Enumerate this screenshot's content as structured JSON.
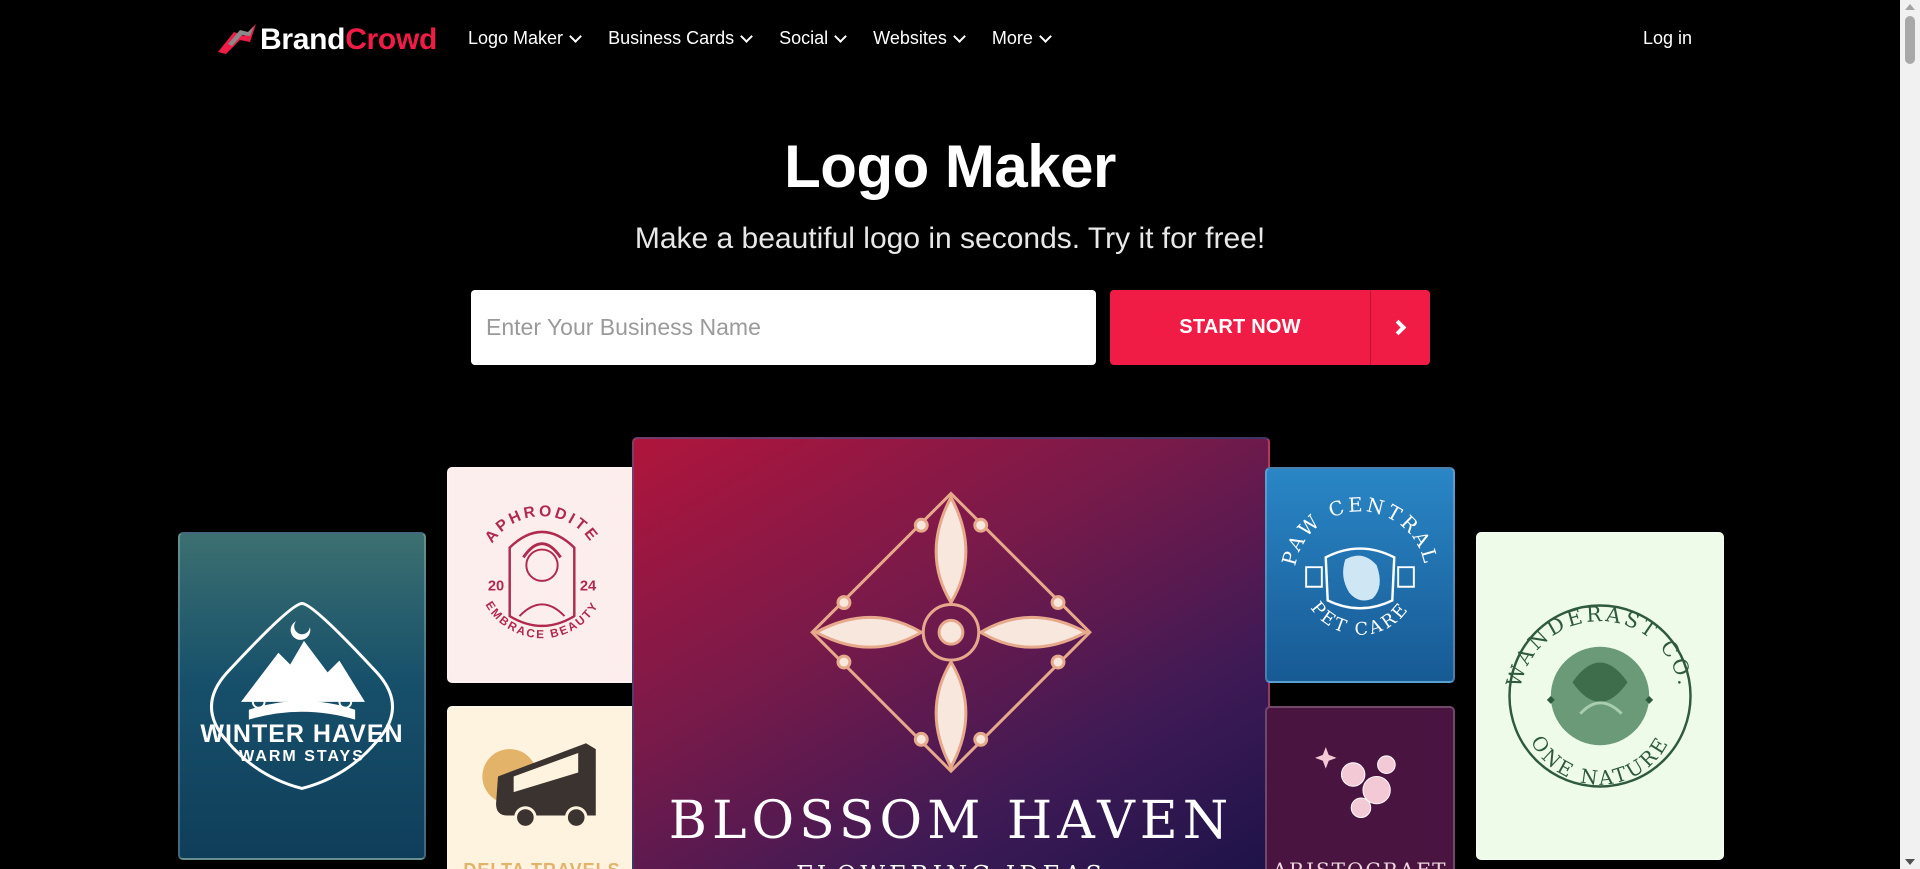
{
  "header": {
    "logo": {
      "brand": "Brand",
      "crowd": "Crowd"
    },
    "nav": [
      {
        "label": "Logo Maker"
      },
      {
        "label": "Business Cards"
      },
      {
        "label": "Social"
      },
      {
        "label": "Websites"
      },
      {
        "label": "More"
      }
    ],
    "login": "Log in"
  },
  "hero": {
    "title": "Logo Maker",
    "subtitle": "Make a beautiful logo in seconds. Try it for free!",
    "search": {
      "placeholder": "Enter Your Business Name",
      "value": ""
    },
    "cta": "START NOW"
  },
  "cards": {
    "winter": {
      "title": "WINTER HAVEN",
      "subtitle": "WARM STAYS"
    },
    "aphrodite": {
      "arc_top": "APHRODITE",
      "year_left": "20",
      "year_right": "24",
      "arc_bottom": "EMBRACE BEAUTY"
    },
    "delta": {
      "title": "DELTA TRAVELS"
    },
    "blossom": {
      "title": "BLOSSOM HAVEN",
      "subtitle": "FLOWERING IDEAS"
    },
    "paw": {
      "arc_top": "PAW CENTRAL",
      "arc_bottom": "PET CARE"
    },
    "aristocraft": {
      "title": "ARISTOCRAFT"
    },
    "wanderast": {
      "arc_top": "WANDERAST CO.",
      "arc_bottom": "ONE NATURE"
    }
  },
  "colors": {
    "accent": "#f01c46",
    "background": "#000000"
  }
}
